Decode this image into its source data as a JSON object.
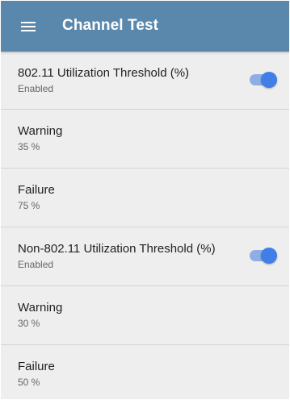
{
  "appbar": {
    "title": "Channel Test",
    "menu_icon": "hamburger-menu-icon",
    "color": "#5a88ad"
  },
  "settings": [
    {
      "label": "802.11 Utilization Threshold (%)",
      "value": "Enabled",
      "toggle": true
    },
    {
      "label": "Warning",
      "value": "35 %"
    },
    {
      "label": "Failure",
      "value": "75 %"
    },
    {
      "label": "Non-802.11 Utilization Threshold (%)",
      "value": "Enabled",
      "toggle": true
    },
    {
      "label": "Warning",
      "value": "30 %"
    },
    {
      "label": "Failure",
      "value": "50 %"
    }
  ],
  "colors": {
    "toggle_on": "#3f7fe6",
    "background": "#eeeeee"
  }
}
